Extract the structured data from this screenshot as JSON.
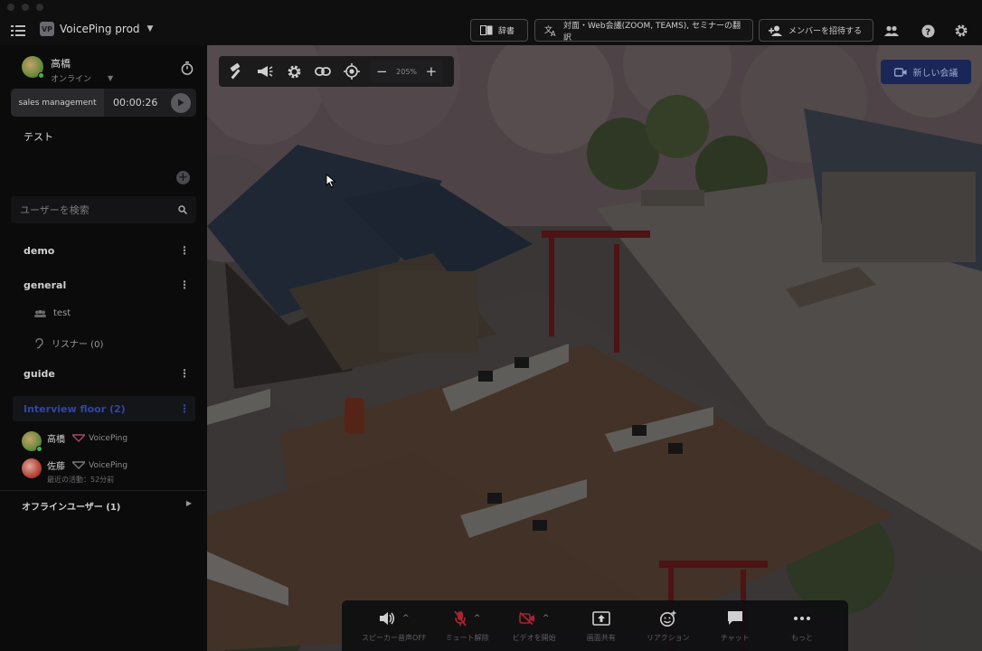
{
  "app": {
    "workspace_name": "VoicePing prod",
    "workspace_logo": "VP"
  },
  "topbar": {
    "dictionary_label": "辞書",
    "translate_label": "対面・Web会議(ZOOM, TEAMS), セミナーの翻訳",
    "invite_label": "メンバーを招待する",
    "icons": [
      "members-icon",
      "help-icon",
      "settings-icon"
    ]
  },
  "sidebar": {
    "user": {
      "name": "高橋",
      "status": "オンライン"
    },
    "session": {
      "name": "sales management",
      "elapsed": "00:00:26"
    },
    "status_message": "テスト",
    "search_placeholder": "ユーザーを検索",
    "channels": [
      {
        "name": "demo"
      },
      {
        "name": "general",
        "items": [
          {
            "label": "test"
          },
          {
            "label": "リスナー (0)"
          }
        ]
      },
      {
        "name": "guide"
      },
      {
        "name": "Interview floor (2)",
        "active": true
      }
    ],
    "members": [
      {
        "name": "高橋",
        "app": "VoicePing",
        "sub": ""
      },
      {
        "name": "佐藤",
        "app": "VoicePing",
        "sub": "最近の活動：52分前"
      }
    ],
    "offline_label": "オフラインユーザー (1)"
  },
  "scene_toolbar": {
    "zoom": "205%",
    "tools": [
      "hammer-icon",
      "megaphone-icon",
      "gear-icon",
      "link-icon",
      "locate-icon"
    ]
  },
  "new_meeting_label": "新しい会議",
  "controls": [
    {
      "label": "スピーカー音声OFF",
      "icon": "speaker-icon",
      "has_caret": true
    },
    {
      "label": "ミュート解除",
      "icon": "mic-off-icon",
      "has_caret": true
    },
    {
      "label": "ビデオを開始",
      "icon": "video-off-icon",
      "has_caret": true
    },
    {
      "label": "画面共有",
      "icon": "screen-share-icon",
      "has_caret": false
    },
    {
      "label": "リアクション",
      "icon": "reaction-icon",
      "has_caret": false
    },
    {
      "label": "チャット",
      "icon": "chat-icon",
      "has_caret": false
    },
    {
      "label": "もっと",
      "icon": "more-icon",
      "has_caret": false
    }
  ],
  "colors": {
    "accent_blue": "#3b5bdb",
    "mute_red": "#c22d3a",
    "online_green": "#46b04a"
  }
}
